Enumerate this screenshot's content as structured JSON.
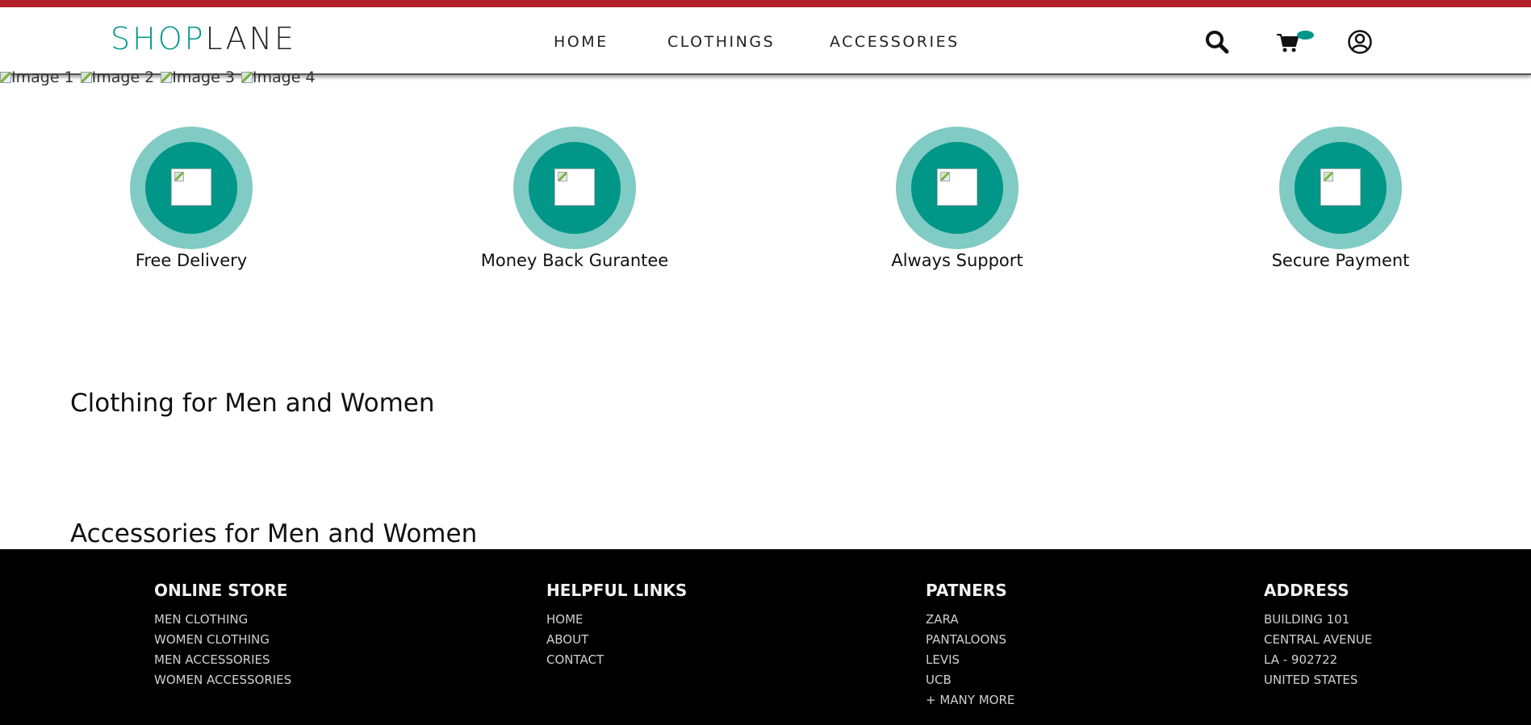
{
  "brand": {
    "logo_part1": "SHOP",
    "logo_part2": "LANE",
    "accent": "#009688",
    "stripe": "#b3202a"
  },
  "nav": {
    "home": "HOME",
    "clothings": "CLOTHINGS",
    "accessories": "ACCESSORIES"
  },
  "header_icons": {
    "search": "search-icon",
    "cart": "cart-icon",
    "user": "user-icon"
  },
  "slider": {
    "images": [
      "Image 1",
      "Image 2",
      "Image 3",
      "Image 4"
    ]
  },
  "features": [
    {
      "label": "Free Delivery"
    },
    {
      "label": "Money Back Gurantee"
    },
    {
      "label": "Always Support"
    },
    {
      "label": "Secure Payment"
    }
  ],
  "sections": {
    "clothing_title": "Clothing for Men and Women",
    "accessories_title": "Accessories for Men and Women"
  },
  "footer": {
    "online_store": {
      "title": "ONLINE STORE",
      "items": [
        "MEN CLOTHING",
        "WOMEN CLOTHING",
        "MEN ACCESSORIES",
        "WOMEN ACCESSORIES"
      ]
    },
    "helpful_links": {
      "title": "HELPFUL LINKS",
      "items": [
        "HOME",
        "ABOUT",
        "CONTACT"
      ]
    },
    "partners": {
      "title": "PATNERS",
      "items": [
        "ZARA",
        "PANTALOONS",
        "LEVIS",
        "UCB",
        "+ MANY MORE"
      ]
    },
    "address": {
      "title": "ADDRESS",
      "items": [
        "BUILDING 101",
        "CENTRAL AVENUE",
        "LA - 902722",
        "UNITED STATES"
      ]
    }
  }
}
